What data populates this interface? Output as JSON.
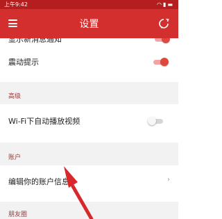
{
  "status_bar": {
    "time": "上午9:42",
    "icons": [
      "wifi-icon",
      "signal-icon",
      "battery-icon"
    ]
  },
  "app_bar": {
    "title": "设置",
    "menu_icon": "menu-icon",
    "action_icon": "refresh-chat-icon"
  },
  "rows": {
    "partial_top": {
      "label": "显示新消息通知",
      "toggle_on": true
    },
    "vibrate": {
      "label": "震动提示",
      "toggle_on": true
    },
    "wifi_autoplay": {
      "label": "Wi-Fi下自动播放视频",
      "toggle_on": false
    },
    "edit_account": {
      "label": "编辑你的账户信息"
    }
  },
  "sections": {
    "advanced": "高级",
    "account": "账户",
    "friends": "朋友圈"
  },
  "colors": {
    "accent": "#d32f2f",
    "status_bar": "#b51e1e",
    "toggle_on": "#e0483d",
    "arrow": "#d8282b"
  }
}
